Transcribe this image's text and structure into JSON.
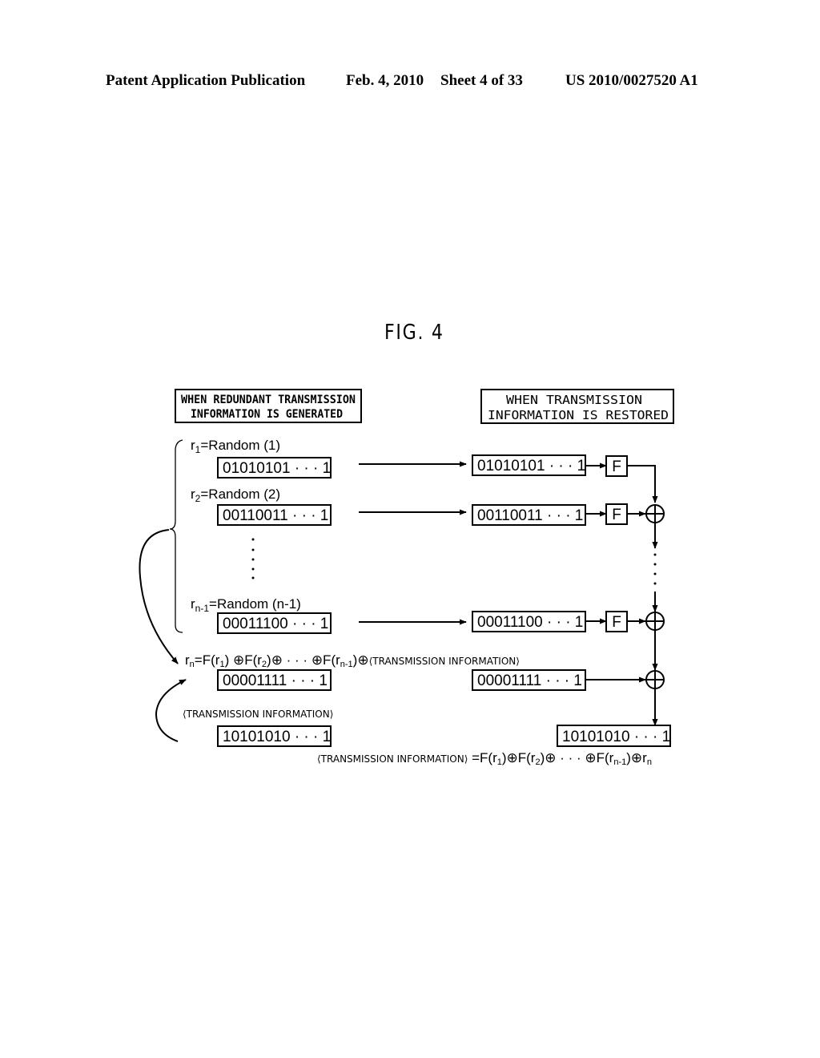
{
  "header": {
    "publication": "Patent Application Publication",
    "date": "Feb. 4, 2010",
    "sheet": "Sheet 4 of 33",
    "number": "US 2010/0027520 A1"
  },
  "figure": {
    "title": "FIG. 4",
    "left_panel": {
      "title_line1": "WHEN REDUNDANT TRANSMISSION",
      "title_line2": "INFORMATION IS GENERATED",
      "rows": [
        {
          "label_prefix": "r",
          "label_sub": "1",
          "label_rest": "=Random (1)",
          "bits": "01010101 · · · 1"
        },
        {
          "label_prefix": "r",
          "label_sub": "2",
          "label_rest": "=Random (2)",
          "bits": "00110011 · · · 1"
        },
        {
          "label_prefix": "r",
          "label_sub": "n-1",
          "label_rest": "=Random (n-1)",
          "bits": "00011100 · · · 1"
        }
      ],
      "rn_formula": {
        "parts": [
          "r",
          "n",
          "=F(r",
          "1",
          ") ⊕F(r",
          "2",
          ")⊕ · · ·  ⊕F(r",
          "n-1",
          ")⊕",
          "⟨TRANSMISSION INFORMATION⟩"
        ]
      },
      "rn_bits": "00001111 · · · 1",
      "transmission_label": "⟨TRANSMISSION INFORMATION⟩",
      "transmission_bits": "10101010 · · · 1",
      "ellipsis": "⋮"
    },
    "right_panel": {
      "title_line1": "WHEN TRANSMISSION",
      "title_line2": "INFORMATION IS RESTORED",
      "rows": [
        {
          "bits": "01010101 · · · 1",
          "function": "F"
        },
        {
          "bits": "00110011 · · · 1",
          "function": "F"
        },
        {
          "bits": "00011100 · · · 1",
          "function": "F"
        }
      ],
      "rn_bits": "00001111 · · · 1",
      "result_bits": "10101010 · · · 1",
      "xor_symbol": "⊕",
      "restore_formula": {
        "parts": [
          "⟨TRANSMISSION INFORMATION⟩",
          " =F(r",
          "1",
          ")⊕F(r",
          "2",
          ")⊕ · · · ⊕F(r",
          "n-1",
          ")⊕r",
          "n"
        ]
      }
    }
  }
}
